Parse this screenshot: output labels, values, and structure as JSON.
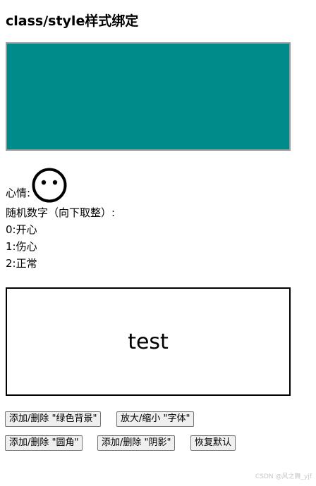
{
  "page": {
    "title": "class/style样式绑定"
  },
  "mood": {
    "label": "心情:",
    "face": "neutral-face-icon"
  },
  "info": {
    "random_label": "随机数字（向下取整）:",
    "states": [
      "0:开心",
      "1:伤心",
      "2:正常"
    ]
  },
  "colors": {
    "teal_box": "#008b8b",
    "teal_border": "#9a9a9a",
    "test_border": "#000000"
  },
  "test_box": {
    "text": "test"
  },
  "buttons": {
    "toggle_green_bg": "添加/删除 \"绿色背景\"",
    "zoom_font": "放大/缩小 \"字体\"",
    "toggle_radius": "添加/删除 \"圆角\"",
    "toggle_shadow": "添加/删除 \"阴影\"",
    "reset": "恢复默认"
  },
  "watermark": "CSDN @风之舞_yjf"
}
